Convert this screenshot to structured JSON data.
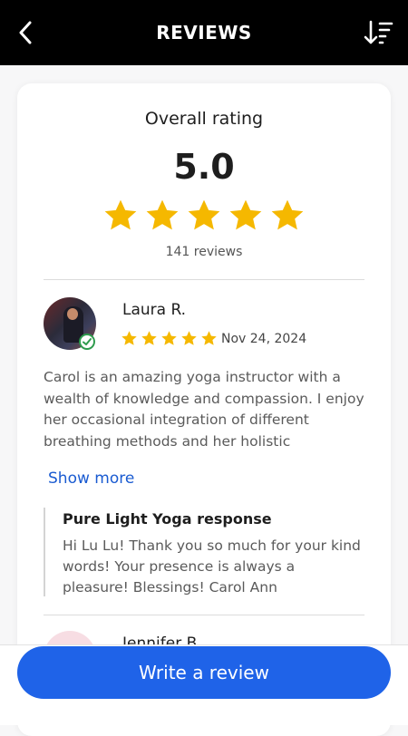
{
  "header": {
    "title": "REVIEWS",
    "back_icon": "chevron-left-icon",
    "sort_icon": "sort-descending-icon"
  },
  "summary": {
    "label": "Overall rating",
    "score": "5.0",
    "stars": 5,
    "max_stars": 5,
    "count_text": "141 reviews"
  },
  "reviews": [
    {
      "name": "Laura R.",
      "verified": true,
      "stars": 5,
      "date": "Nov 24, 2024",
      "text": "Carol is an amazing yoga instructor with a wealth of knowledge and compassion. I enjoy her occasional integration of different breathing methods and her holistic approach...",
      "show_more": "Show more",
      "response": {
        "title": "Pure Light Yoga response",
        "text": "Hi Lu Lu! Thank you so much for your kind words! Your presence is always a pleasure! Blessings! Carol Ann"
      }
    },
    {
      "name": "Jennifer B."
    }
  ],
  "footer": {
    "button_label": "Write a review"
  },
  "colors": {
    "header_bg": "#000000",
    "star": "#f5b800",
    "link": "#1a5bd1",
    "button": "#1f63e8",
    "verified": "#2e9b4d"
  }
}
